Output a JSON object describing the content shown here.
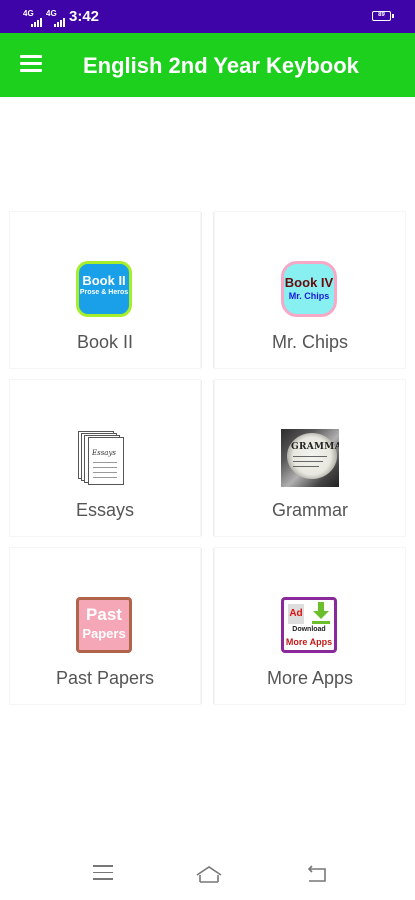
{
  "status_bar": {
    "network_1": "4G",
    "network_2": "4G",
    "time": "3:42",
    "battery": "89"
  },
  "app_bar": {
    "menu_icon": "hamburger-menu-icon",
    "title": "English 2nd Year Keybook"
  },
  "tiles": [
    {
      "label": "Book II",
      "icon": "book-ii-icon",
      "icon_text": [
        "Book II",
        "Prose & Heros"
      ]
    },
    {
      "label": "Mr. Chips",
      "icon": "book-iv-icon",
      "icon_text": [
        "Book IV",
        "Mr. Chips"
      ]
    },
    {
      "label": "Essays",
      "icon": "essays-icon",
      "icon_text": [
        "Essays"
      ]
    },
    {
      "label": "Grammar",
      "icon": "grammar-icon",
      "icon_text": [
        "GRAMMAR"
      ]
    },
    {
      "label": "Past Papers",
      "icon": "past-papers-icon",
      "icon_text": [
        "Past",
        "Papers"
      ]
    },
    {
      "label": "More Apps",
      "icon": "more-apps-icon",
      "icon_text": [
        "Ad",
        "Download",
        "More Apps"
      ]
    }
  ],
  "nav_bar": {
    "menu_icon": "recent-apps-icon",
    "home_icon": "home-icon",
    "back_icon": "back-icon"
  },
  "colors": {
    "status_bar": "#3f04a8",
    "app_bar": "#1ed01e",
    "label_text": "#555555"
  }
}
